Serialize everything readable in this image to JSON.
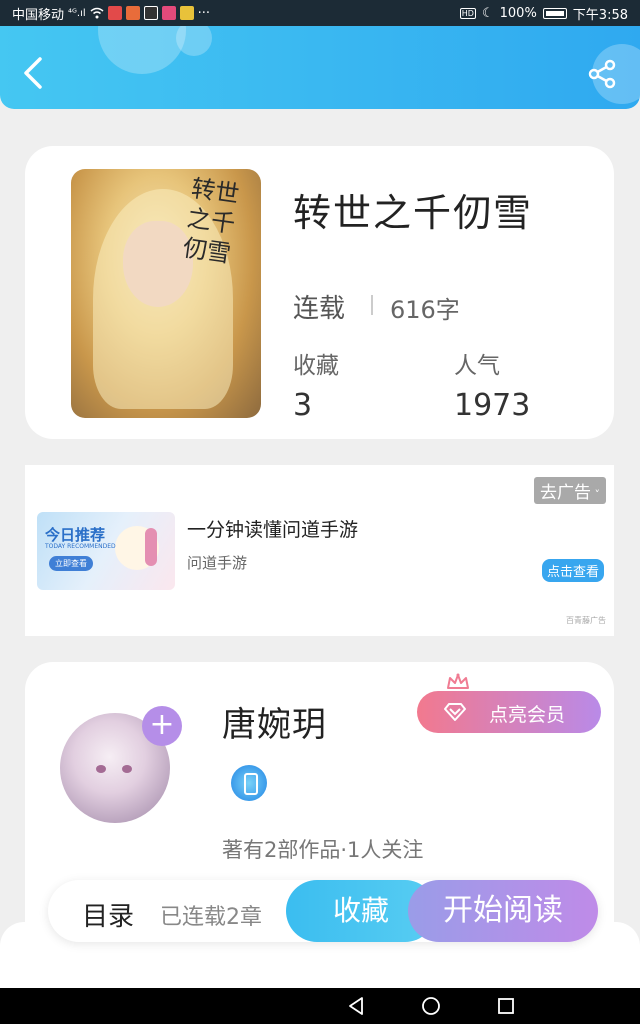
{
  "status_bar": {
    "carrier": "中国移动",
    "signal": "⁴ᴳ.ıl",
    "more": "···",
    "battery": "100%",
    "time": "下午3:58"
  },
  "header": {
    "back_icon": "chevron-left-icon",
    "share_icon": "share-icon"
  },
  "book": {
    "title": "转世之千仞雪",
    "cover_art_text": "转世之千仞雪",
    "status": "连载",
    "word_count": "616字",
    "stats": [
      {
        "label": "收藏",
        "value": "3"
      },
      {
        "label": "人气",
        "value": "1973"
      }
    ]
  },
  "ad": {
    "close_label": "去广告",
    "image_title": "今日推荐",
    "image_subtitle": "TODAY RECOMMENDED",
    "image_button": "立即查看",
    "title": "一分钟读懂问道手游",
    "subtitle": "问道手游",
    "cta": "点击查看",
    "source": "百青藤广告"
  },
  "author": {
    "name": "唐婉玥",
    "vip_label": "点亮会员",
    "stats": "著有2部作品·1人关注",
    "plus": "+"
  },
  "action_bar": {
    "toc": "目录",
    "chapters": "已连载2章",
    "collect": "收藏",
    "read": "开始阅读"
  },
  "colors": {
    "header_gradient_start": "#45c7f2",
    "header_gradient_end": "#2fa9f0",
    "collect_button": "#3bbdf0",
    "read_button_start": "#9a9ce8",
    "read_button_end": "#bf8be8",
    "vip_start": "#f2798e",
    "vip_end": "#b98ae8"
  }
}
